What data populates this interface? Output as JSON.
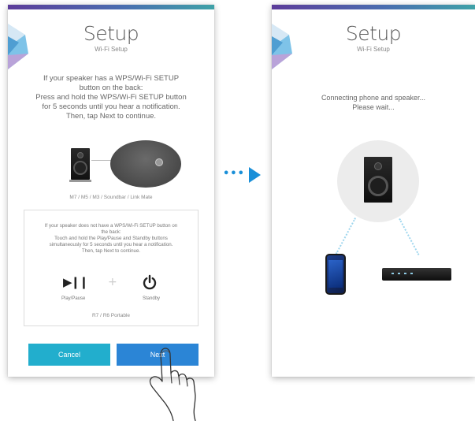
{
  "screen1": {
    "title": "Setup",
    "subtitle": "Wi-Fi Setup",
    "instructions": [
      "If your speaker has a WPS/Wi-Fi SETUP",
      "button on the back:",
      "Press and hold the WPS/Wi-Fi SETUP button",
      "for 5 seconds until you hear a notification.",
      "Then, tap Next to continue."
    ],
    "models_primary": "M7 / M5 / M3 / Soundbar / Link Mate",
    "alternative_instructions": [
      "If your speaker does not have a WPS/Wi-Fi SETUP button on",
      "the back:",
      "Touch and hold the Play/Pause and Standby buttons",
      "simultaneously for 5 seconds until you hear a notification.",
      "Then, tap Next to continue."
    ],
    "playpause_label": "Play/Pause",
    "standby_label": "Standby",
    "models_secondary": "R7 / R6 Portable",
    "cancel_label": "Cancel",
    "next_label": "Next"
  },
  "screen2": {
    "title": "Setup",
    "subtitle": "Wi-Fi Setup",
    "status": [
      "Connecting phone and speaker...",
      "Please wait..."
    ]
  },
  "colors": {
    "cancel_button": "#22aecd",
    "next_button": "#2b85d6",
    "arrow": "#1a8fd8",
    "top_bar_start": "#5c3c9a",
    "top_bar_end": "#3fa2a8"
  },
  "icons": {
    "logo": "brand-logo-icon",
    "speaker": "speaker-icon",
    "play_pause": "play-pause-icon",
    "plus": "plus-icon",
    "power": "power-icon",
    "hand": "hand-tap-icon",
    "arrow": "arrow-right-icon",
    "phone": "smartphone-icon",
    "router": "router-icon"
  }
}
